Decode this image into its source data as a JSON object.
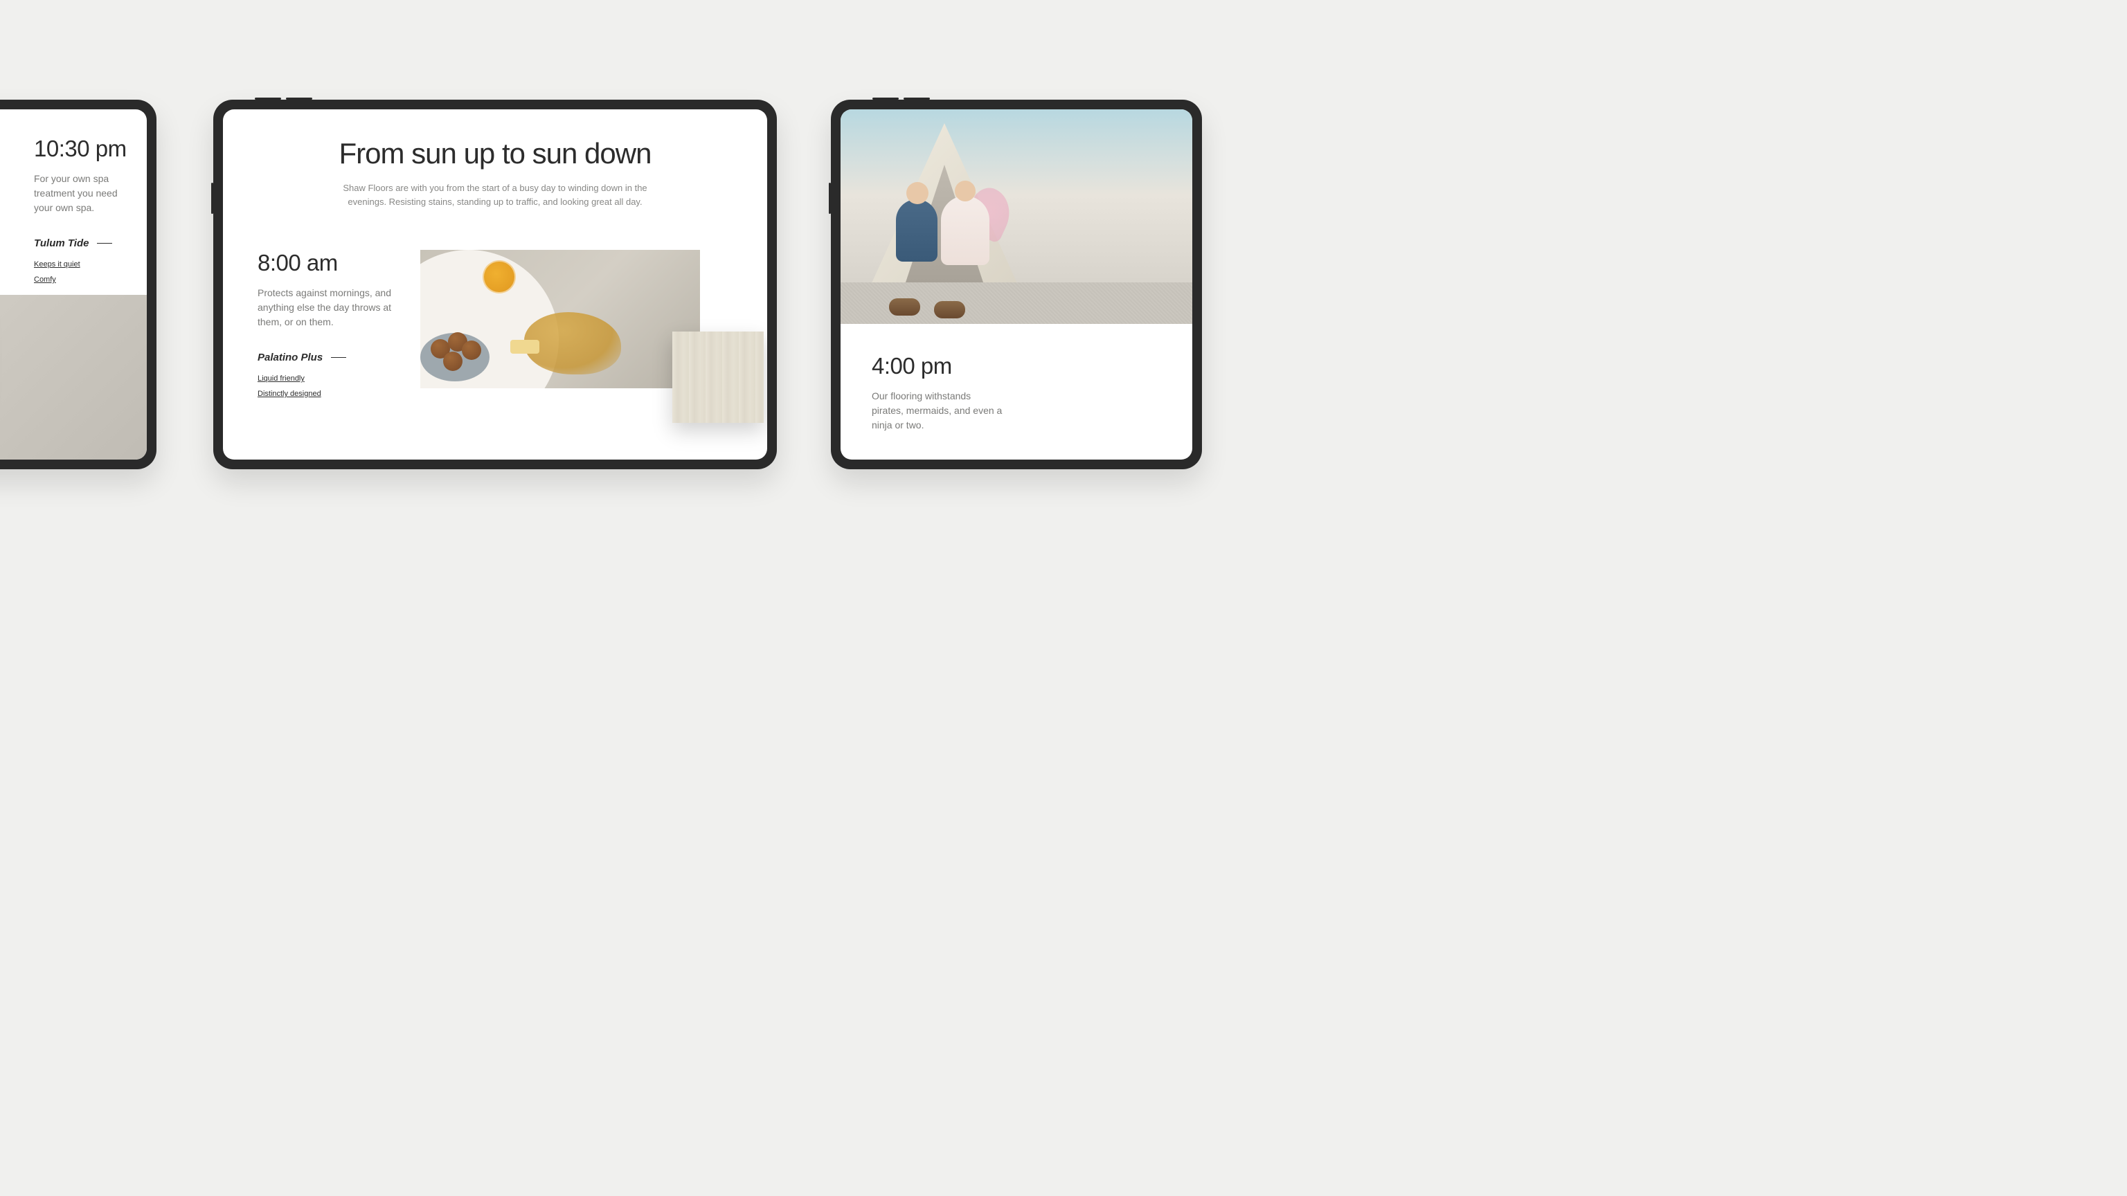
{
  "left_tablet": {
    "time": "10:30 pm",
    "description": "For your own spa treatment you need your own spa.",
    "product": "Tulum Tide",
    "features": [
      "Keeps it quiet",
      "Comfy"
    ]
  },
  "center_tablet": {
    "hero_title": "From sun up to sun down",
    "hero_subtitle": "Shaw Floors are with you from the start of a busy day to winding down in the evenings. Resisting stains, standing up to traffic, and looking great all day.",
    "time": "8:00 am",
    "description": "Protects against mornings, and anything else the day throws at them, or on them.",
    "product": "Palatino Plus",
    "features": [
      "Liquid friendly",
      "Distinctly designed"
    ]
  },
  "right_tablet": {
    "time": "4:00 pm",
    "description": "Our flooring withstands pirates, mermaids, and even a ninja or two."
  }
}
